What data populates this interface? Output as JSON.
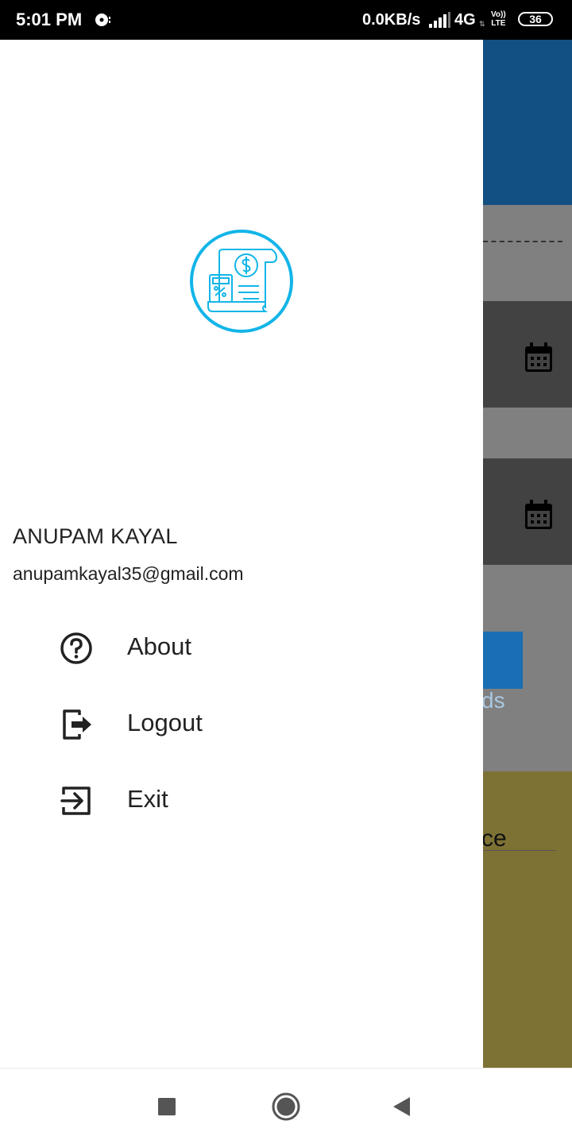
{
  "status_bar": {
    "time": "5:01 PM",
    "network_speed": "0.0KB/s",
    "network_type": "4G",
    "volte_line1": "Vo))",
    "volte_line2": "LTE",
    "battery": "36",
    "icons": [
      "media-icon",
      "signal-icon",
      "data-arrows-icon",
      "battery-icon"
    ]
  },
  "background_app": {
    "button_text": "ds",
    "field_text": "ce",
    "colors": {
      "header": "#124f82",
      "card": "#424242",
      "button": "#1a6eb3",
      "panel": "#7d7134"
    },
    "icons": [
      "calendar-icon",
      "calendar-icon"
    ]
  },
  "drawer": {
    "logo_icon": "invoice-receipt-icon",
    "logo_color": "#12b5e8",
    "user": {
      "name": "ANUPAM KAYAL",
      "email": "anupamkayal35@gmail.com"
    },
    "menu": [
      {
        "label": "About",
        "icon": "help-circle-icon"
      },
      {
        "label": "Logout",
        "icon": "logout-icon"
      },
      {
        "label": "Exit",
        "icon": "exit-icon"
      }
    ]
  },
  "nav_bar": {
    "buttons": [
      "recent-apps-icon",
      "home-icon",
      "back-icon"
    ]
  }
}
